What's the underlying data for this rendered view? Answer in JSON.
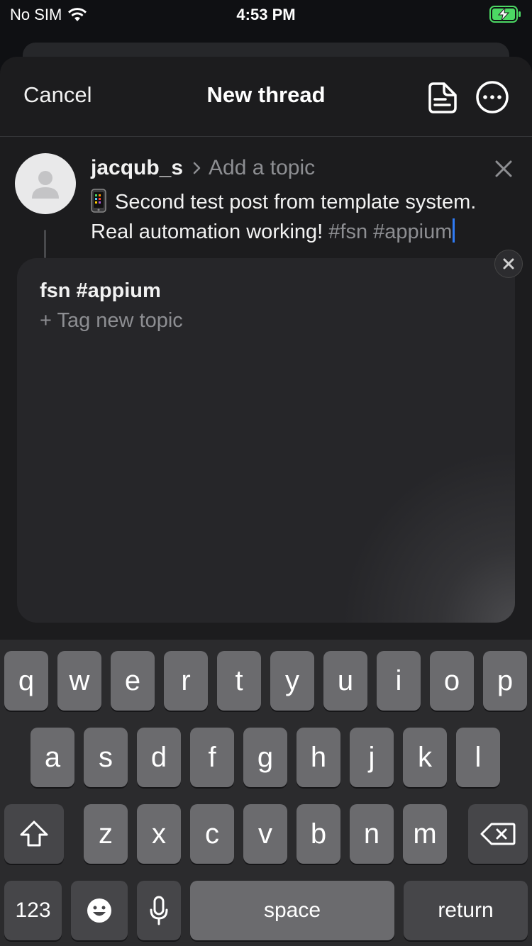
{
  "status_bar": {
    "carrier": "No SIM",
    "time": "4:53 PM"
  },
  "nav": {
    "cancel_label": "Cancel",
    "title": "New thread",
    "draft_icon": "drafts-icon",
    "more_icon": "more-icon"
  },
  "compose": {
    "username": "jacqub_s",
    "topic_placeholder": "Add a topic",
    "emoji": "📱",
    "text_line1": "Second test post from template system.",
    "text_line2": "Real automation working!",
    "hashtags": "#fsn #appium"
  },
  "suggestions": {
    "item": "fsn #appium",
    "new_topic": "+ Tag new topic"
  },
  "keyboard": {
    "row1": [
      "q",
      "w",
      "e",
      "r",
      "t",
      "y",
      "u",
      "i",
      "o",
      "p"
    ],
    "row2": [
      "a",
      "s",
      "d",
      "f",
      "g",
      "h",
      "j",
      "k",
      "l"
    ],
    "row3": [
      "z",
      "x",
      "c",
      "v",
      "b",
      "n",
      "m"
    ],
    "numbers_label": "123",
    "space_label": "space",
    "return_label": "return"
  },
  "colors": {
    "accent": "#2f7bf5",
    "sheet_bg": "#1c1c1e",
    "battery": "#4cd964"
  }
}
